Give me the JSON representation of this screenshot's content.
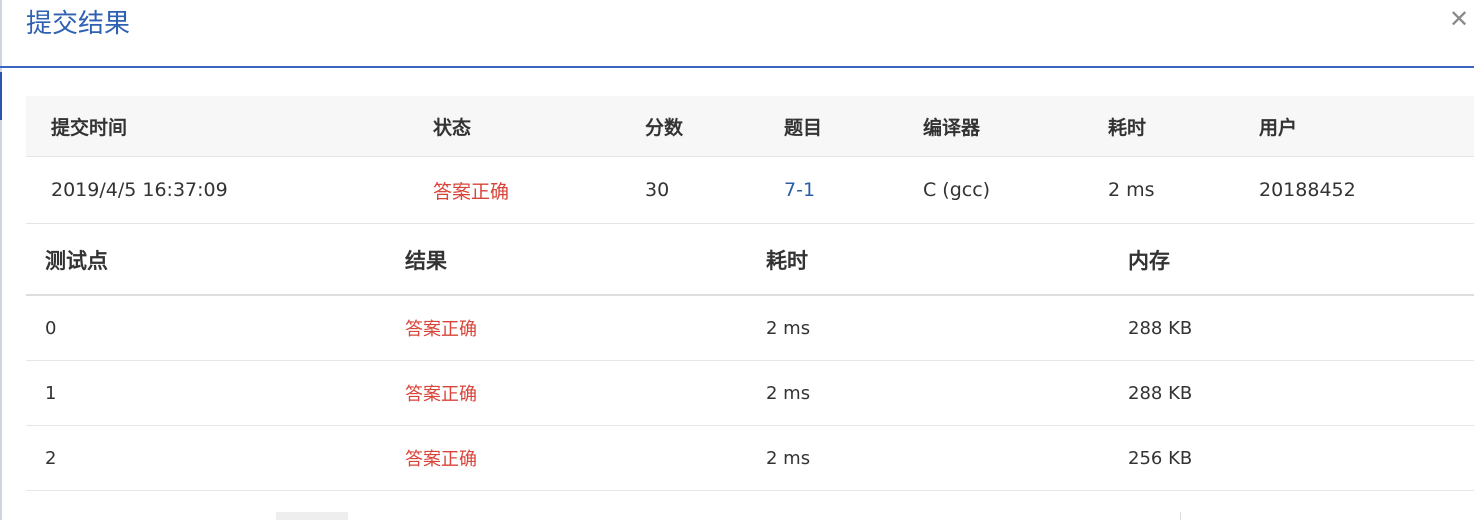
{
  "modal": {
    "title": "提交结果",
    "close_glyph": "✕"
  },
  "summary": {
    "headers": [
      "提交时间",
      "状态",
      "分数",
      "题目",
      "编译器",
      "耗时",
      "用户"
    ],
    "row": {
      "submit_time": "2019/4/5 16:37:09",
      "status": "答案正确",
      "score": "30",
      "problem": "7-1",
      "compiler": "C (gcc)",
      "time": "2 ms",
      "user": "20188452"
    }
  },
  "cases": {
    "headers": [
      "测试点",
      "结果",
      "耗时",
      "内存"
    ],
    "rows": [
      {
        "id": "0",
        "result": "答案正确",
        "time": "2 ms",
        "memory": "288 KB"
      },
      {
        "id": "1",
        "result": "答案正确",
        "time": "2 ms",
        "memory": "288 KB"
      },
      {
        "id": "2",
        "result": "答案正确",
        "time": "2 ms",
        "memory": "256 KB"
      }
    ]
  },
  "colors": {
    "accent": "#2f61b2",
    "success": "#d9443a",
    "link": "#2a5fa8"
  }
}
